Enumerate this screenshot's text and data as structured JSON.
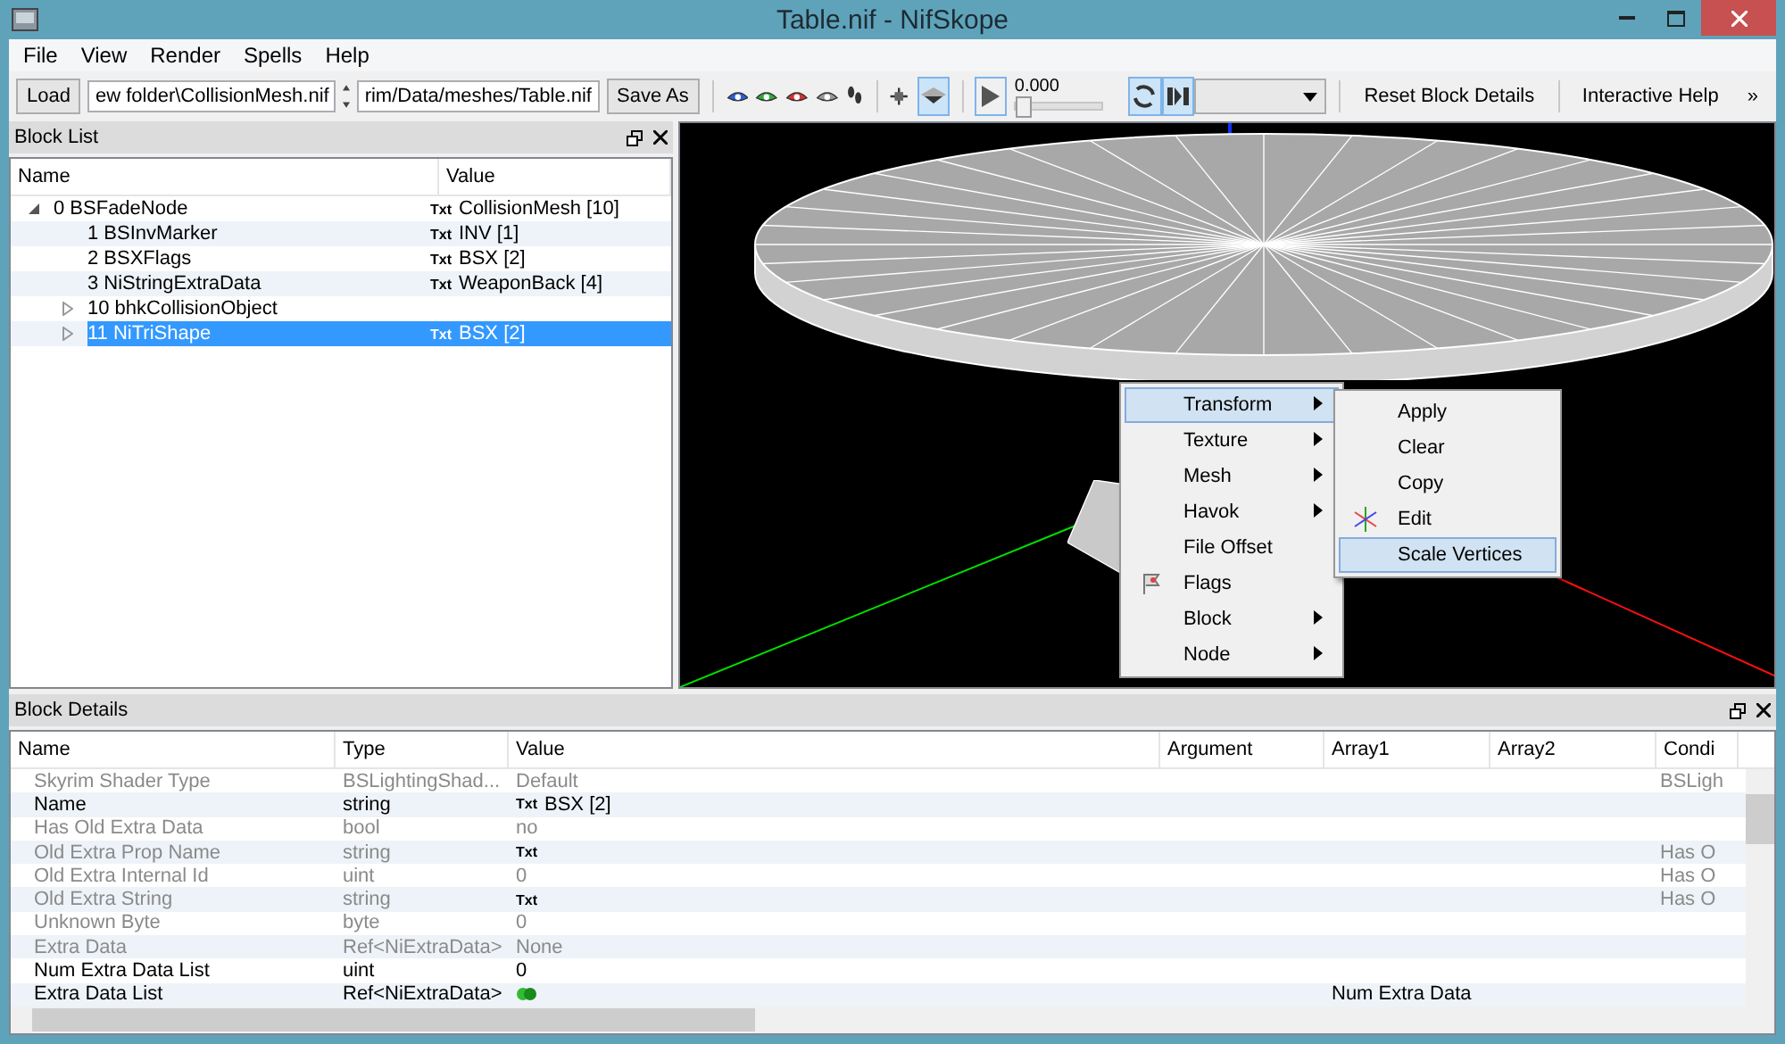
{
  "window": {
    "title": "Table.nif - NifSkope"
  },
  "menu": [
    "File",
    "View",
    "Render",
    "Spells",
    "Help"
  ],
  "toolbar": {
    "load": "Load",
    "path_1": "ew folder\\CollisionMesh.nif",
    "path_2": "rim/Data/meshes/Table.nif",
    "save_as": "Save As",
    "visibility_selected": true,
    "play_selected": false,
    "time": "0.000",
    "time_slider": {
      "level": 0
    },
    "loop_selected": true,
    "switch_selected": true,
    "actions": [
      "Reset Block Details",
      "Interactive Help"
    ],
    "more": "»"
  },
  "block_list": {
    "title": "Block List",
    "columns": [
      "Name",
      "Value"
    ],
    "rows": [
      {
        "name": "0 BSFadeNode",
        "tag": "Txt",
        "value": "CollisionMesh [10]",
        "expanded": true,
        "selected": false,
        "children": [
          {
            "name": "1 BSInvMarker",
            "tag": "Txt",
            "value": "INV [1]",
            "selected": false
          },
          {
            "name": "2 BSXFlags",
            "tag": "Txt",
            "value": "BSX [2]",
            "selected": false
          },
          {
            "name": "3 NiStringExtraData",
            "tag": "Txt",
            "value": "WeaponBack [4]",
            "selected": false
          },
          {
            "name": "10 bhkCollisionObject",
            "expanded": false,
            "selected": false
          },
          {
            "name": "11 NiTriShape",
            "tag": "Txt",
            "value": "BSX [2]",
            "expanded": false,
            "selected": true
          }
        ]
      }
    ]
  },
  "context_menu": {
    "items": [
      {
        "label": "Transform",
        "kind": "submenu",
        "selected": true
      },
      {
        "label": "Texture",
        "kind": "submenu",
        "selected": false
      },
      {
        "label": "Mesh",
        "kind": "submenu",
        "selected": false
      },
      {
        "label": "Havok",
        "kind": "submenu",
        "selected": false
      },
      {
        "label": "File Offset",
        "kind": "action",
        "selected": false
      },
      {
        "label": "Flags",
        "kind": "flag_action",
        "selected": false
      },
      {
        "label": "Block",
        "kind": "submenu",
        "selected": false
      },
      {
        "label": "Node",
        "kind": "submenu",
        "selected": false
      }
    ],
    "submenu": [
      {
        "label": "Apply",
        "kind": "action",
        "selected": false
      },
      {
        "label": "Clear",
        "kind": "action",
        "selected": false
      },
      {
        "label": "Copy",
        "kind": "action",
        "selected": false
      },
      {
        "label": "Edit",
        "kind": "axes_action",
        "selected": false
      },
      {
        "label": "Scale Vertices",
        "kind": "action",
        "selected": true
      }
    ]
  },
  "block_details": {
    "title": "Block Details",
    "columns": [
      "Name",
      "Type",
      "Value",
      "Argument",
      "Array1",
      "Array2",
      "Condi"
    ],
    "rows": [
      {
        "name": "Skyrim Shader Type",
        "type": "BSLightingShad...",
        "value": "Default",
        "condition": "BSLigh",
        "disabled": true
      },
      {
        "name": "Name",
        "type": "string",
        "tag": "Txt",
        "value": "BSX [2]",
        "disabled": false
      },
      {
        "name": "Has Old Extra Data",
        "type": "bool",
        "value": "no",
        "disabled": true
      },
      {
        "name": "Old Extra Prop Name",
        "type": "string",
        "tag": "Txt",
        "condition": "Has O",
        "disabled": true
      },
      {
        "name": "Old Extra Internal Id",
        "type": "uint",
        "value": "0",
        "condition": "Has O",
        "disabled": true
      },
      {
        "name": "Old Extra String",
        "type": "string",
        "tag": "Txt",
        "condition": "Has O",
        "disabled": true
      },
      {
        "name": "Unknown Byte",
        "type": "byte",
        "value": "0",
        "disabled": true
      },
      {
        "name": "Extra Data",
        "type": "Ref<NiExtraData>",
        "value": "None",
        "disabled": true
      },
      {
        "name": "Num Extra Data List",
        "type": "uint",
        "value": "0",
        "disabled": false
      },
      {
        "name": "Extra Data List",
        "type": "Ref<NiExtraData>",
        "kind": "link_list",
        "array1": "Num Extra Data",
        "disabled": false
      }
    ]
  }
}
